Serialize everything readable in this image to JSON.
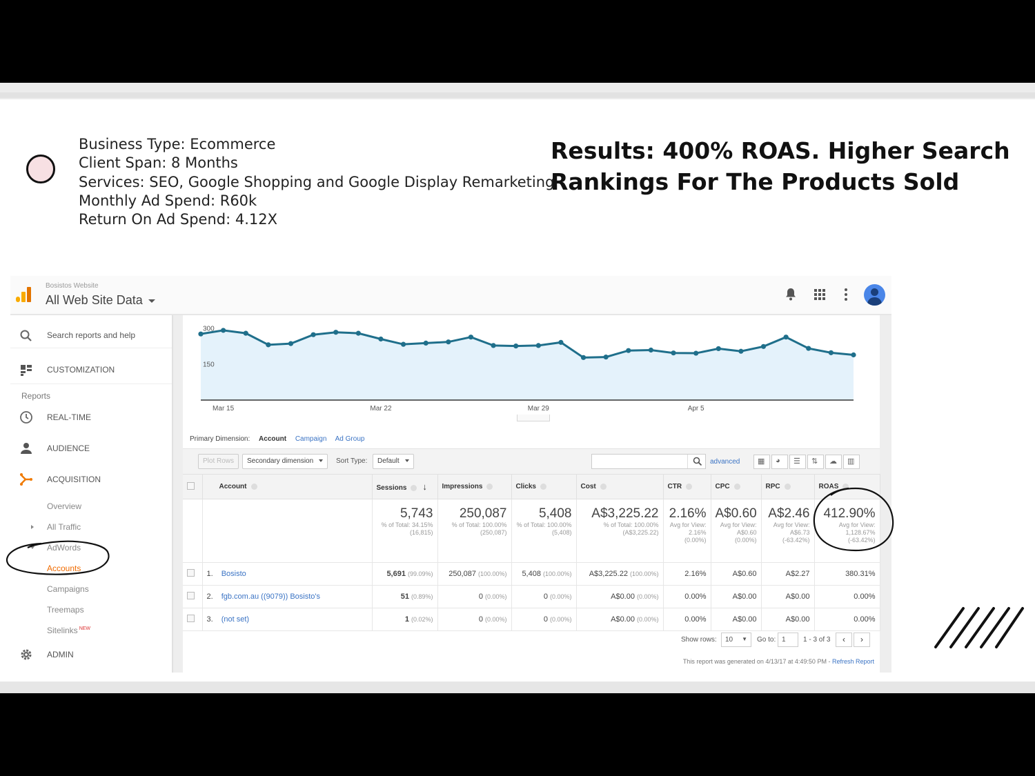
{
  "slide": {
    "info_lines": [
      "Business Type: Ecommerce",
      "Client Span: 8 Months",
      "Services: SEO, Google Shopping and Google Display Remarketing",
      "Monthly Ad Spend: R60k",
      "Return On Ad Spend: 4.12X"
    ],
    "results_line1": "Results: 400% ROAS. Higher Search",
    "results_line2": "Rankings For The Products Sold"
  },
  "ga": {
    "property": "Bosistos Website",
    "view": "All Web Site Data",
    "sidebar": {
      "search_placeholder": "Search reports and help",
      "customization": "CUSTOMIZATION",
      "reports_heading": "Reports",
      "realtime": "REAL-TIME",
      "audience": "AUDIENCE",
      "acquisition": "ACQUISITION",
      "overview": "Overview",
      "all_traffic": "All Traffic",
      "adwords": "AdWords",
      "accounts": "Accounts",
      "campaigns": "Campaigns",
      "treemaps": "Treemaps",
      "sitelinks": "Sitelinks",
      "sitelinks_badge": "NEW",
      "admin": "ADMIN"
    },
    "primary_dimension": {
      "label": "Primary Dimension:",
      "account": "Account",
      "campaign": "Campaign",
      "ad_group": "Ad Group"
    },
    "controls": {
      "plot_rows": "Plot Rows",
      "secondary_dimension": "Secondary dimension",
      "sort_type_label": "Sort Type:",
      "sort_type_value": "Default",
      "advanced": "advanced"
    },
    "table": {
      "headers": [
        "Account",
        "Sessions",
        "Impressions",
        "Clicks",
        "Cost",
        "CTR",
        "CPC",
        "RPC",
        "ROAS"
      ],
      "totals": {
        "sessions": "5,743",
        "sessions_sub": "% of Total: 34.15% (16,815)",
        "impressions": "250,087",
        "impressions_sub": "% of Total: 100.00% (250,087)",
        "clicks": "5,408",
        "clicks_sub": "% of Total: 100.00% (5,408)",
        "cost": "A$3,225.22",
        "cost_sub": "% of Total: 100.00% (A$3,225.22)",
        "ctr": "2.16%",
        "ctr_sub": "Avg for View: 2.16% (0.00%)",
        "cpc": "A$0.60",
        "cpc_sub": "Avg for View: A$0.60 (0.00%)",
        "rpc": "A$2.46",
        "rpc_sub": "Avg for View: A$6.73 (-63.42%)",
        "roas": "412.90%",
        "roas_sub": "Avg for View: 1,128.67% (-63.42%)"
      },
      "rows": [
        {
          "num": "1.",
          "account": "Bosisto",
          "sessions": "5,691",
          "sessions_pct": "(99.09%)",
          "impressions": "250,087",
          "impressions_pct": "(100.00%)",
          "clicks": "5,408",
          "clicks_pct": "(100.00%)",
          "cost": "A$3,225.22",
          "cost_pct": "(100.00%)",
          "ctr": "2.16%",
          "cpc": "A$0.60",
          "rpc": "A$2.27",
          "roas": "380.31%"
        },
        {
          "num": "2.",
          "account": "fgb.com.au ((9079)) Bosisto's",
          "sessions": "51",
          "sessions_pct": "(0.89%)",
          "impressions": "0",
          "impressions_pct": "(0.00%)",
          "clicks": "0",
          "clicks_pct": "(0.00%)",
          "cost": "A$0.00",
          "cost_pct": "(0.00%)",
          "ctr": "0.00%",
          "cpc": "A$0.00",
          "rpc": "A$0.00",
          "roas": "0.00%"
        },
        {
          "num": "3.",
          "account": "(not set)",
          "sessions": "1",
          "sessions_pct": "(0.02%)",
          "impressions": "0",
          "impressions_pct": "(0.00%)",
          "clicks": "0",
          "clicks_pct": "(0.00%)",
          "cost": "A$0.00",
          "cost_pct": "(0.00%)",
          "ctr": "0.00%",
          "cpc": "A$0.00",
          "rpc": "A$0.00",
          "roas": "0.00%"
        }
      ]
    },
    "pager": {
      "show_rows_label": "Show rows:",
      "show_rows_value": "10",
      "goto_label": "Go to:",
      "goto_value": "1",
      "range": "1 - 3 of 3"
    },
    "footnote": "This report was generated on 4/13/17 at 4:49:50 PM -",
    "refresh": "Refresh Report"
  },
  "chart_data": {
    "type": "area",
    "ytick_labels": [
      "300",
      "150"
    ],
    "xtick_labels": [
      "Mar 15",
      "Mar 22",
      "Mar 29",
      "Apr 5"
    ],
    "ylim": [
      0,
      330
    ],
    "x": [
      "Mar 14",
      "Mar 15",
      "Mar 16",
      "Mar 17",
      "Mar 18",
      "Mar 19",
      "Mar 20",
      "Mar 21",
      "Mar 22",
      "Mar 23",
      "Mar 24",
      "Mar 25",
      "Mar 26",
      "Mar 27",
      "Mar 28",
      "Mar 29",
      "Mar 30",
      "Mar 31",
      "Apr 1",
      "Apr 2",
      "Apr 3",
      "Apr 4",
      "Apr 5",
      "Apr 6",
      "Apr 7",
      "Apr 8",
      "Apr 9",
      "Apr 10",
      "Apr 11",
      "Apr 12"
    ],
    "values": [
      275,
      290,
      278,
      230,
      235,
      272,
      282,
      278,
      254,
      232,
      237,
      242,
      262,
      227,
      225,
      227,
      240,
      177,
      179,
      206,
      208,
      196,
      195,
      214,
      203,
      223,
      262,
      215,
      197,
      188
    ],
    "color": "#1f6f8b",
    "fill": "#e4f2fb"
  }
}
